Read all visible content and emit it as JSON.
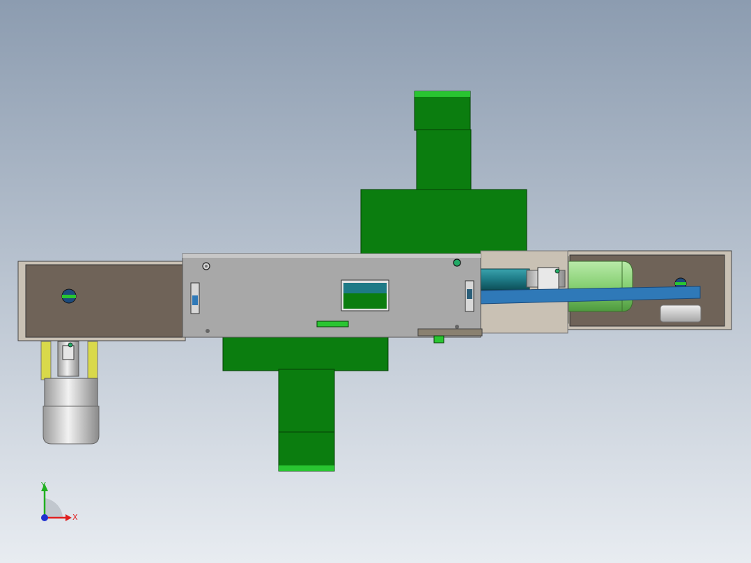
{
  "viewport": {
    "background_top": "#8c9cb0",
    "background_bottom": "#e8ecf1"
  },
  "colors": {
    "green_plate": "#0b7d0f",
    "green_plate_light": "#29c531",
    "housing_brown": "#6f6358",
    "housing_frame": "#c9c1b4",
    "steel_plate": "#a8a8a8",
    "belt_blue": "#2f79b8",
    "motor_green": "#8ad27a",
    "cylinder_teal": "#1e7a86",
    "rod_yellow": "#d9d94a",
    "motor_silver": "#c8c8c8",
    "axis_x": "#e02020",
    "axis_y": "#20b020",
    "axis_z": "#2030d0"
  },
  "triad": {
    "x_label": "X",
    "y_label": "Y"
  }
}
